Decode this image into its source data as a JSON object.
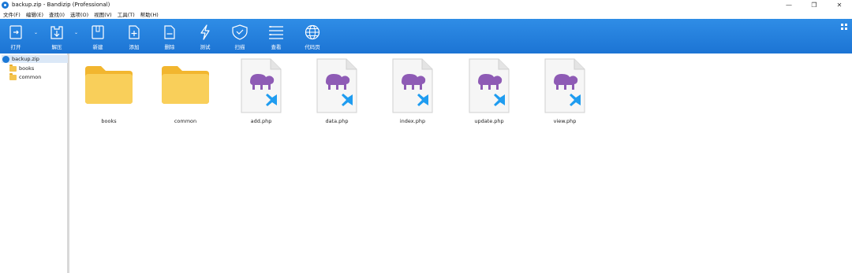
{
  "window": {
    "title": "backup.zip - Bandizip (Professional)",
    "controls": [
      "—",
      "❐",
      "✕"
    ]
  },
  "menu": [
    "文件(F)",
    "编辑(E)",
    "查找(I)",
    "选项(O)",
    "视图(V)",
    "工具(T)",
    "帮助(H)"
  ],
  "toolbar": {
    "open": "打开",
    "extract": "解压",
    "new": "新建",
    "add": "添加",
    "delete": "删除",
    "test": "测试",
    "scan": "扫描",
    "view": "查看",
    "codepage": "代码页"
  },
  "tree": {
    "root": "backup.zip",
    "children": [
      "books",
      "common"
    ]
  },
  "files": [
    {
      "name": "books",
      "type": "folder"
    },
    {
      "name": "common",
      "type": "folder"
    },
    {
      "name": "add.php",
      "type": "php"
    },
    {
      "name": "data.php",
      "type": "php"
    },
    {
      "name": "index.php",
      "type": "php"
    },
    {
      "name": "update.php",
      "type": "php"
    },
    {
      "name": "view.php",
      "type": "php"
    }
  ],
  "colors": {
    "toolbar": "#2f8de6",
    "folder": "#f4c44e",
    "php_elephant": "#8e5bb5",
    "vscode_blue": "#1f9cf0"
  }
}
